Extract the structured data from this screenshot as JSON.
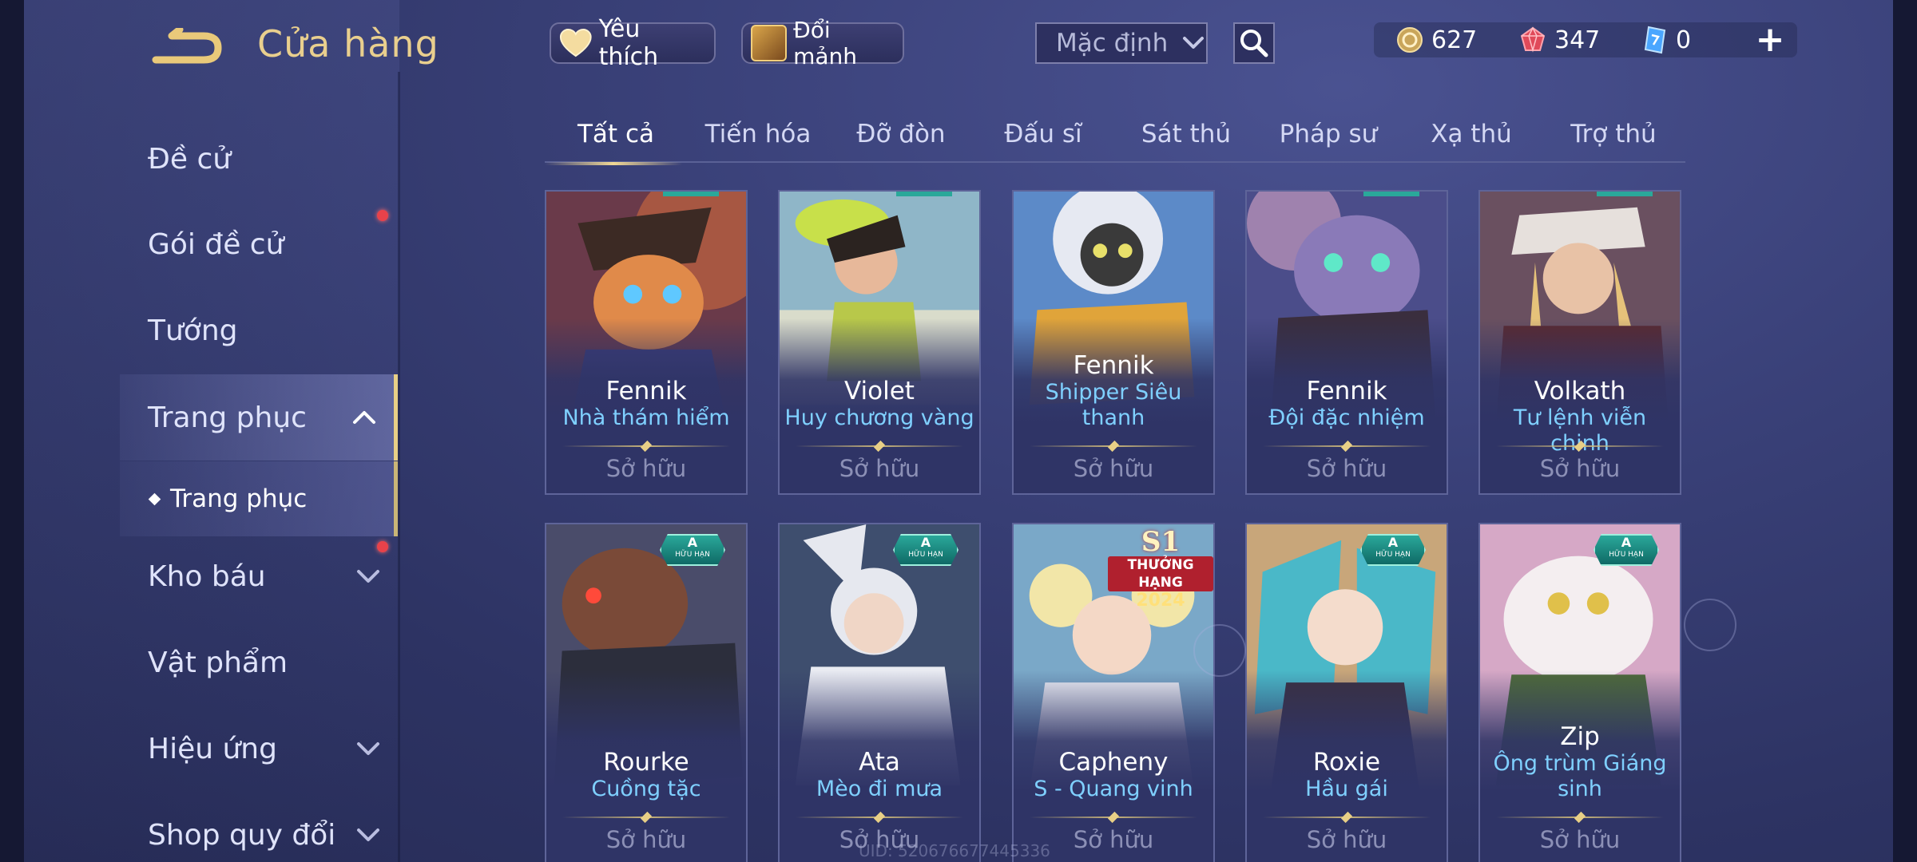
{
  "header": {
    "title": "Cửa hàng",
    "favorite_label": "Yêu thích",
    "shard_exchange_label": "Đổi mảnh",
    "sort_value": "Mặc định"
  },
  "currencies": {
    "gold": "627",
    "ruby": "347",
    "voucher": "0"
  },
  "sidebar": {
    "items": [
      {
        "label": "Đề cử"
      },
      {
        "label": "Gói đề cử"
      },
      {
        "label": "Tướng"
      },
      {
        "label": "Trang phục"
      },
      {
        "label": "Kho báu"
      },
      {
        "label": "Vật phẩm"
      },
      {
        "label": "Hiệu ứng"
      },
      {
        "label": "Shop quy đổi"
      }
    ],
    "sub_item": "Trang phục"
  },
  "tabs": [
    {
      "label": "Tất cả"
    },
    {
      "label": "Tiến hóa"
    },
    {
      "label": "Đỡ đòn"
    },
    {
      "label": "Đấu sĩ"
    },
    {
      "label": "Sát thủ"
    },
    {
      "label": "Pháp sư"
    },
    {
      "label": "Xạ thủ"
    },
    {
      "label": "Trợ thủ"
    }
  ],
  "cards": [
    {
      "hero": "Fennik",
      "skin": "Nhà thám hiểm",
      "status": "Sở hữu"
    },
    {
      "hero": "Violet",
      "skin": "Huy chương vàng",
      "status": "Sở hữu"
    },
    {
      "hero": "Fennik",
      "skin": "Shipper Siêu thanh",
      "status": "Sở hữu"
    },
    {
      "hero": "Fennik",
      "skin": "Đội đặc nhiệm",
      "status": "Sở hữu"
    },
    {
      "hero": "Volkath",
      "skin": "Tư lệnh viễn chinh",
      "status": "Sở hữu"
    },
    {
      "hero": "Rourke",
      "skin": "Cuồng tặc",
      "status": "Sở hữu",
      "badge_tier": "A",
      "badge_label": "HỮU HẠN"
    },
    {
      "hero": "Ata",
      "skin": "Mèo đi mưa",
      "status": "Sở hữu",
      "badge_tier": "A",
      "badge_label": "HỮU HẠN"
    },
    {
      "hero": "Capheny",
      "skin": "S - Quang vinh",
      "status": "Sở hữu",
      "badge_s1": "S1",
      "badge_rank": "THƯỞNG HẠNG",
      "badge_year": "2024"
    },
    {
      "hero": "Roxie",
      "skin": "Hầu gái",
      "status": "Sở hữu",
      "badge_tier": "A",
      "badge_label": "HỮU HẠN"
    },
    {
      "hero": "Zip",
      "skin": "Ông trùm Giáng sinh",
      "status": "Sở hữu",
      "badge_tier": "A",
      "badge_label": "HỮU HẠN"
    }
  ],
  "uid_text": "UID: 520676677445336",
  "colors": {
    "gold_accent": "#e9cf8e",
    "skin_name": "#7fd0ff",
    "owned_text": "#8c90b6",
    "notification_dot": "#e8424a"
  },
  "icons": {
    "back": "back-arrow-icon",
    "favorite": "heart-icon",
    "shard": "shard-icon",
    "search": "search-icon",
    "gold": "gold-coin-icon",
    "ruby": "ruby-icon",
    "voucher": "voucher-icon",
    "add": "plus-icon"
  }
}
